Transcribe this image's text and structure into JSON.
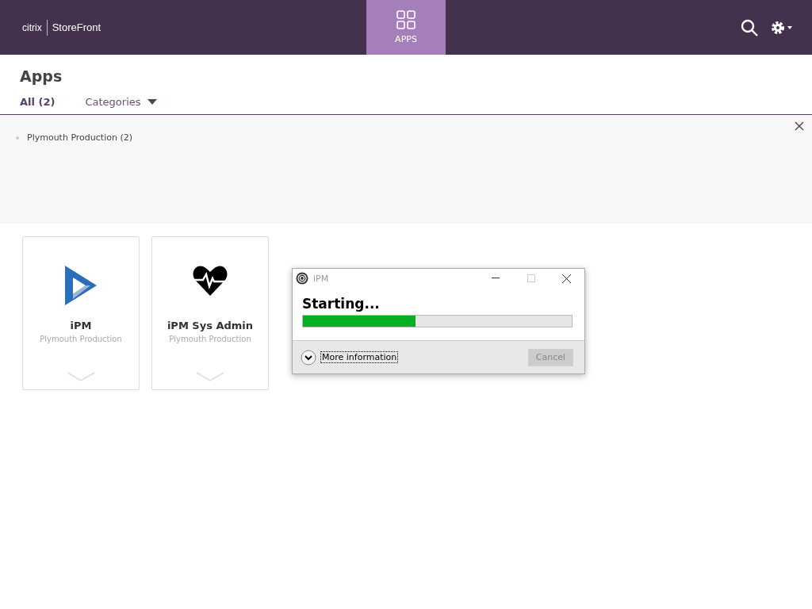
{
  "header": {
    "logo_brand": "citrix",
    "logo_product": "StoreFront",
    "nav": [
      {
        "label": "APPS",
        "selected": true
      }
    ]
  },
  "page": {
    "title": "Apps",
    "tabs": [
      {
        "label": "All (2)",
        "selected": true,
        "kind": "plain"
      },
      {
        "label": "Categories",
        "selected": false,
        "kind": "dropdown"
      }
    ]
  },
  "categories": [
    {
      "label": "Plymouth Production (2)"
    }
  ],
  "apps": [
    {
      "name": "iPM",
      "subtitle": "Plymouth Production",
      "kind": "play"
    },
    {
      "name": "iPM Sys Admin",
      "subtitle": "Plymouth Production",
      "kind": "heart"
    }
  ],
  "dialog": {
    "title": "iPM",
    "status": "Starting...",
    "progress": {
      "level": 0.42
    },
    "more_info": "More information",
    "cancel": {
      "label": "Cancel",
      "disabled": true
    },
    "maximize": {
      "disabled": true
    }
  }
}
